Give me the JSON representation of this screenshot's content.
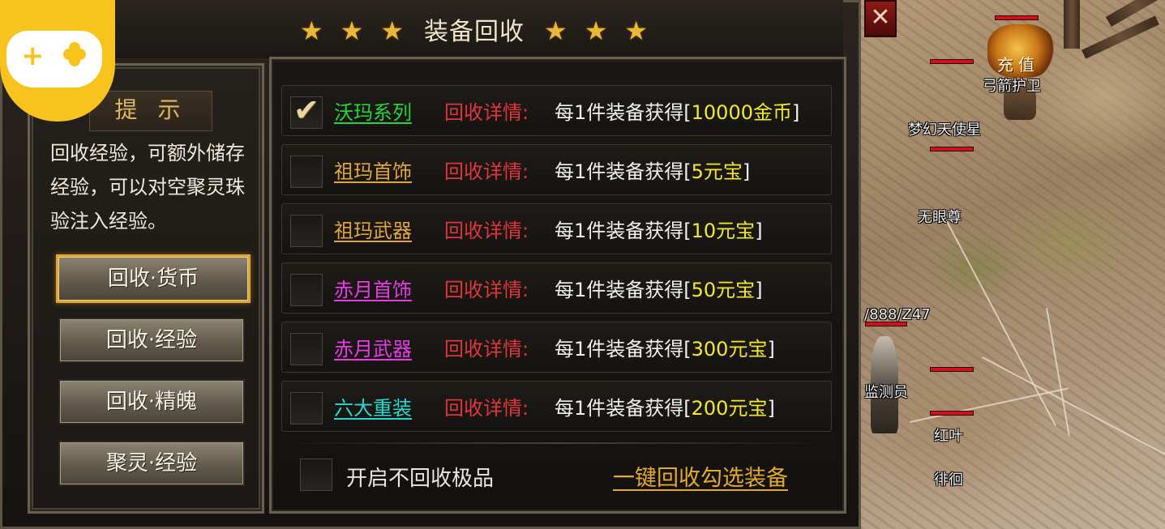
{
  "panel": {
    "title": "装备回收",
    "stars": [
      "★",
      "★",
      "★",
      "★",
      "★",
      "★"
    ]
  },
  "tip": {
    "title": "提 示",
    "text": "回收经验，可额外储存经验，可以对空聚灵珠验注入经验。"
  },
  "side_buttons": [
    {
      "label": "回收·货币",
      "active": true
    },
    {
      "label": "回收·经验",
      "active": false
    },
    {
      "label": "回收·精魄",
      "active": false
    },
    {
      "label": "聚灵·经验",
      "active": false
    }
  ],
  "rows": [
    {
      "name": "沃玛系列",
      "color": "#27d33c",
      "checked": true,
      "detail_label": "回收详情:",
      "text_prefix": "每1件装备获得[",
      "value": "10000金币",
      "text_suffix": "]"
    },
    {
      "name": "祖玛首饰",
      "color": "#e0a63a",
      "checked": false,
      "detail_label": "回收详情:",
      "text_prefix": "每1件装备获得[",
      "value": "5元宝",
      "text_suffix": "]"
    },
    {
      "name": "祖玛武器",
      "color": "#e0a63a",
      "checked": false,
      "detail_label": "回收详情:",
      "text_prefix": "每1件装备获得[",
      "value": "10元宝",
      "text_suffix": "]"
    },
    {
      "name": "赤月首饰",
      "color": "#e63be6",
      "checked": false,
      "detail_label": "回收详情:",
      "text_prefix": "每1件装备获得[",
      "value": "50元宝",
      "text_suffix": "]"
    },
    {
      "name": "赤月武器",
      "color": "#e63be6",
      "checked": false,
      "detail_label": "回收详情:",
      "text_prefix": "每1件装备获得[",
      "value": "300元宝",
      "text_suffix": "]"
    },
    {
      "name": "六大重装",
      "color": "#28d7d0",
      "checked": false,
      "detail_label": "回收详情:",
      "text_prefix": "每1件装备获得[",
      "value": "200元宝",
      "text_suffix": "]"
    }
  ],
  "bottom": {
    "no_recycle_label": "开启不回收极品",
    "one_key_label": "一键回收勾选装备"
  },
  "world": {
    "close_label": "✕",
    "recharge_label": "充值",
    "names": [
      "弓箭护卫",
      "梦幻天使星",
      "无眼尊",
      "/888/Z47",
      "监测员",
      "红叶",
      "徘徊"
    ]
  }
}
